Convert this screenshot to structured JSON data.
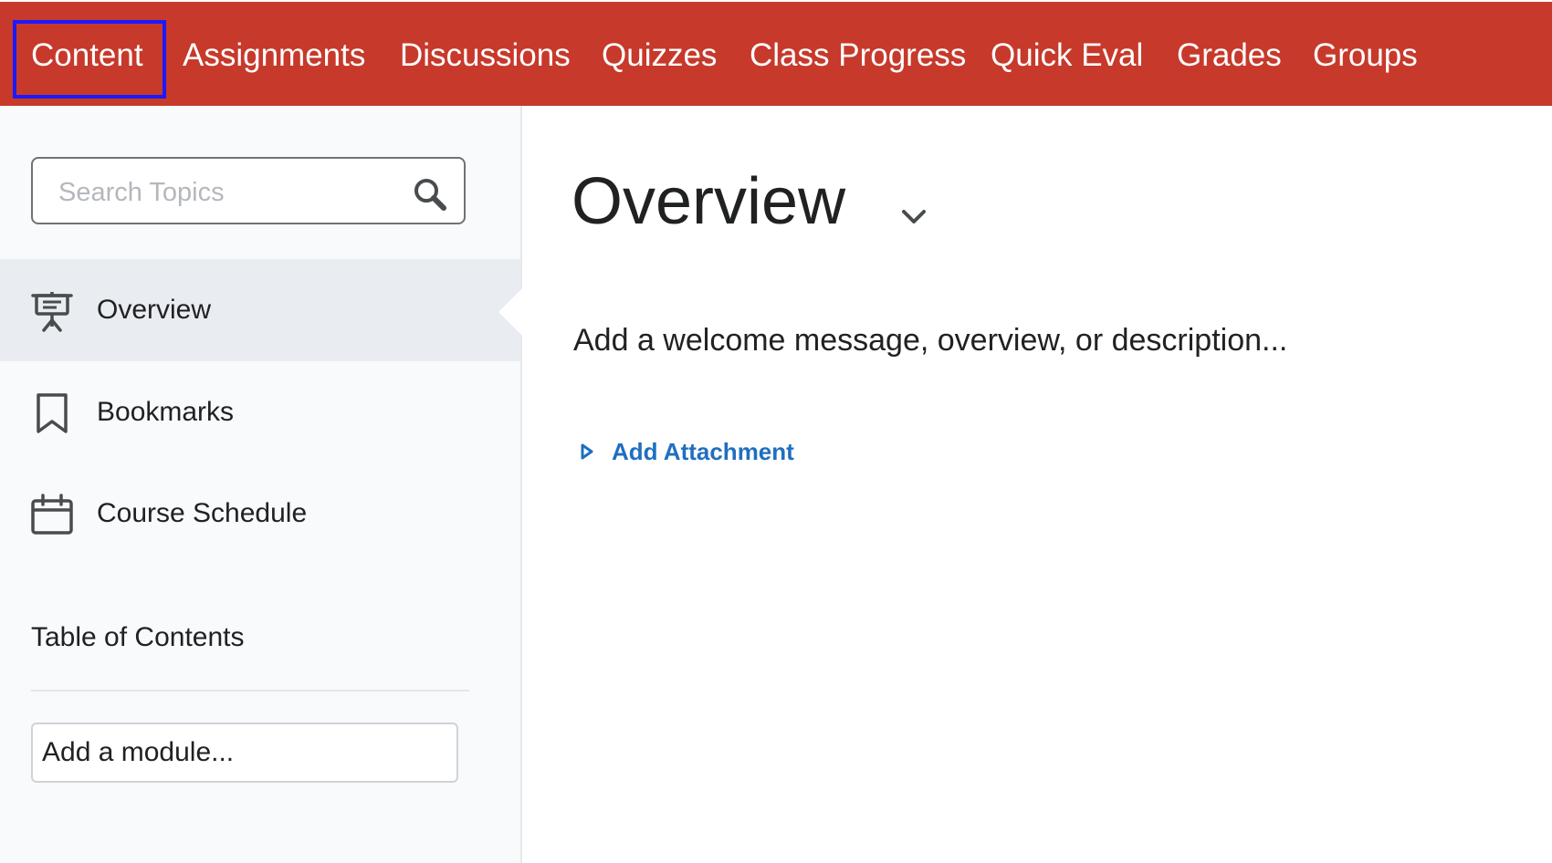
{
  "nav": {
    "items": [
      {
        "label": "Content"
      },
      {
        "label": "Assignments"
      },
      {
        "label": "Discussions"
      },
      {
        "label": "Quizzes"
      },
      {
        "label": "Class Progress"
      },
      {
        "label": "Quick Eval"
      },
      {
        "label": "Grades"
      },
      {
        "label": "Groups"
      }
    ],
    "selected": "Content",
    "bar_color": "#c7392b",
    "highlight_color": "#1a1aff"
  },
  "sidebar": {
    "search": {
      "placeholder": "Search Topics",
      "value": "",
      "icon": "search-icon"
    },
    "items": [
      {
        "label": "Overview",
        "icon": "presentation-icon",
        "active": true
      },
      {
        "label": "Bookmarks",
        "icon": "bookmark-icon",
        "active": false
      },
      {
        "label": "Course Schedule",
        "icon": "calendar-icon",
        "active": false
      }
    ],
    "toc_heading": "Table of Contents",
    "module_input": {
      "placeholder": "Add a module...",
      "value": ""
    }
  },
  "main": {
    "title": "Overview",
    "description": "Add a welcome message, overview, or description...",
    "attachment_link": "Add Attachment",
    "link_color": "#1f6fbf"
  }
}
